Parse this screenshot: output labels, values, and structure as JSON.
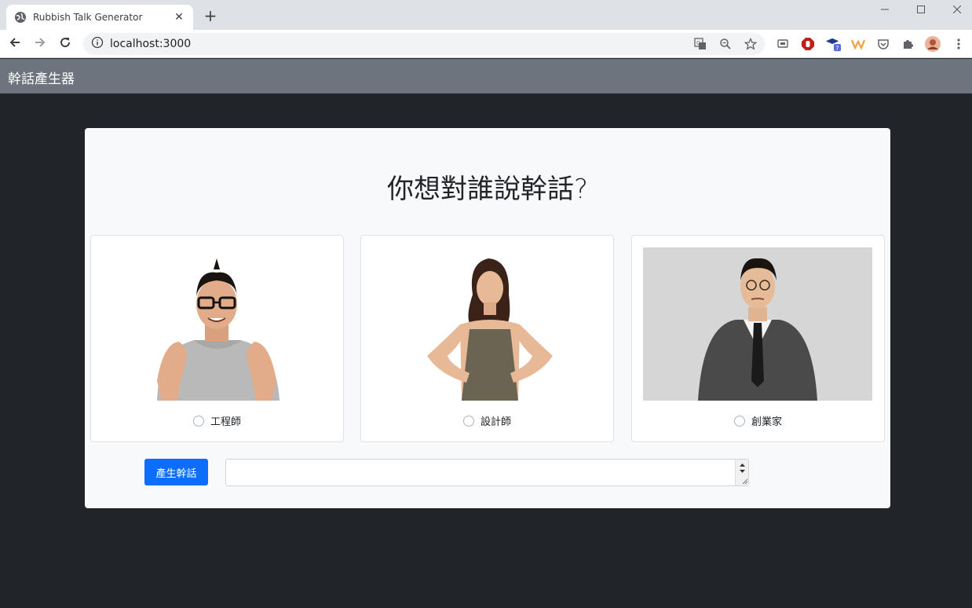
{
  "browser": {
    "tab_title": "Rubbish Talk Generator",
    "tab_close": "✕",
    "new_tab": "+",
    "url": "localhost:3000",
    "extension_badge": "7"
  },
  "app": {
    "brand": "幹話產生器",
    "heading": "你想對誰說幹話?",
    "options": [
      {
        "label": "工程師",
        "selected": false
      },
      {
        "label": "設計師",
        "selected": false
      },
      {
        "label": "創業家",
        "selected": false
      }
    ],
    "generate_button": "產生幹話",
    "output_value": ""
  },
  "colors": {
    "page_bg": "#212529",
    "navbar_bg": "#6c757d",
    "card_bg": "#f8f9fa",
    "button_bg": "#0d6efd"
  },
  "icons": [
    "globe-icon",
    "back-arrow-icon",
    "forward-arrow-icon",
    "reload-icon",
    "info-icon",
    "translate-icon",
    "zoom-icon",
    "star-icon",
    "puzzle-icon",
    "menu-icon"
  ]
}
